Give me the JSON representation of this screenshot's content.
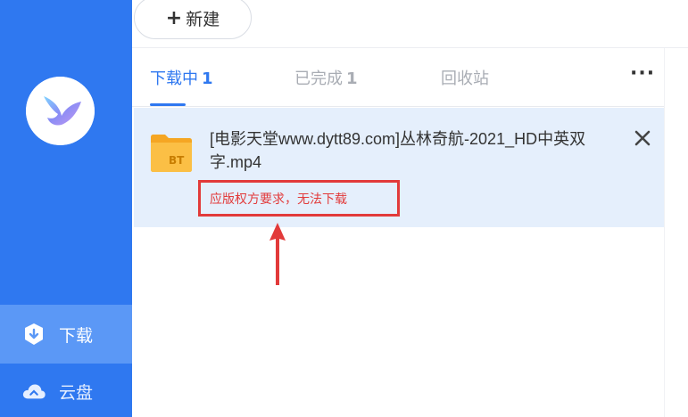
{
  "sidebar": {
    "nav": [
      {
        "label": "下载",
        "icon": "download-shield-icon",
        "active": true
      },
      {
        "label": "云盘",
        "icon": "cloud-icon",
        "active": false
      }
    ]
  },
  "toolbar": {
    "new_label": "新建",
    "new_icon": "plus-icon"
  },
  "tabs": [
    {
      "label": "下载中",
      "count": "1",
      "active": true
    },
    {
      "label": "已完成",
      "count": "1",
      "active": false
    },
    {
      "label": "回收站",
      "count": "",
      "active": false
    }
  ],
  "more_label": "···",
  "download_item": {
    "file_badge": "BT",
    "name": "[电影天堂www.dytt89.com]丛林奇航-2021_HD中英双字.mp4",
    "status": "应版权方要求，无法下载"
  },
  "colors": {
    "accent": "#2f78f0",
    "sidebar_active": "#5b98f6",
    "item_bg": "#e5effc",
    "error": "#e23a3a"
  }
}
